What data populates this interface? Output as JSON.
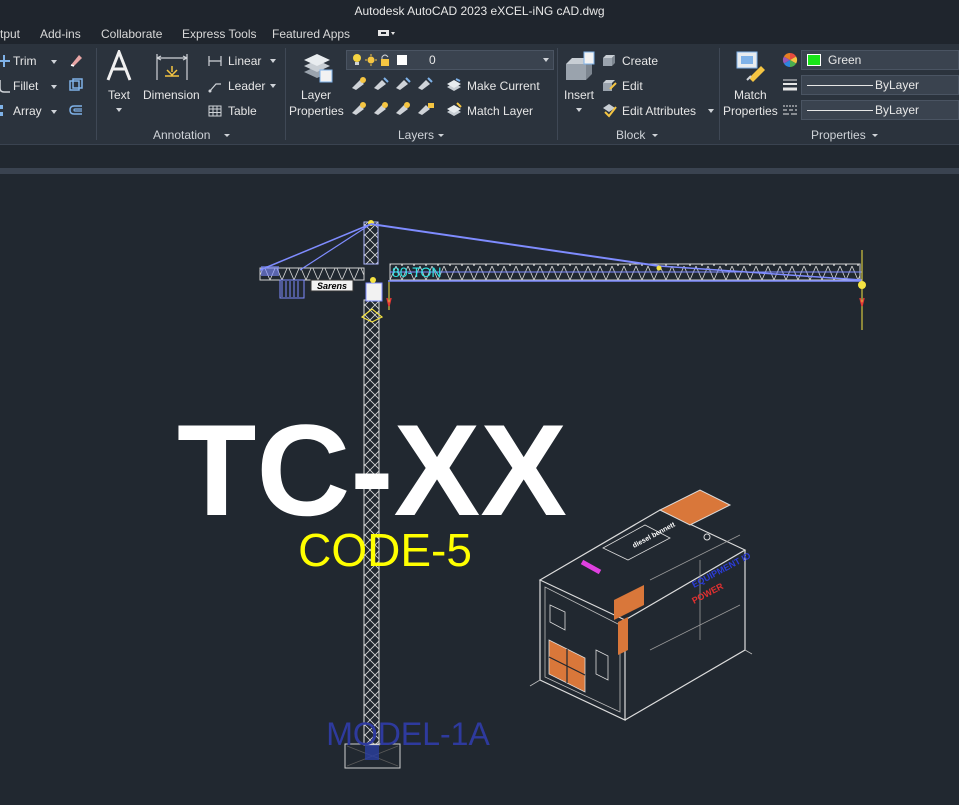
{
  "window": {
    "title": "Autodesk AutoCAD 2023    eXCEL-iNG cAD.dwg"
  },
  "menu": {
    "tabs": [
      "tput",
      "Add-ins",
      "Collaborate",
      "Express Tools",
      "Featured Apps"
    ]
  },
  "modify": {
    "trim": "Trim",
    "fillet": "Fillet",
    "array": "Array"
  },
  "annotation": {
    "title": "Annotation",
    "text": "Text",
    "dimension": "Dimension",
    "linear": "Linear",
    "leader": "Leader",
    "table": "Table"
  },
  "layers": {
    "title": "Layers",
    "properties_line1": "Layer",
    "properties_line2": "Properties",
    "current_layer": "0",
    "make_current": "Make Current",
    "match_layer": "Match Layer"
  },
  "block": {
    "title": "Block",
    "insert": "Insert",
    "create": "Create",
    "edit": "Edit",
    "edit_attributes": "Edit Attributes"
  },
  "properties": {
    "title": "Properties",
    "match_line1": "Match",
    "match_line2": "Properties",
    "color": "Green",
    "linetype": "ByLayer",
    "lineweight": "ByLayer",
    "color_hex": "#19e619"
  },
  "drawing": {
    "crane_label": "80-TON",
    "brand": "Sarens",
    "main_title": "TC-XX",
    "code": "CODE-5",
    "model": "MODEL-1A",
    "gen_brand": "diesel bennett",
    "gen_label_1": "EQUIPMENT ID",
    "gen_label_2": "POWER"
  }
}
